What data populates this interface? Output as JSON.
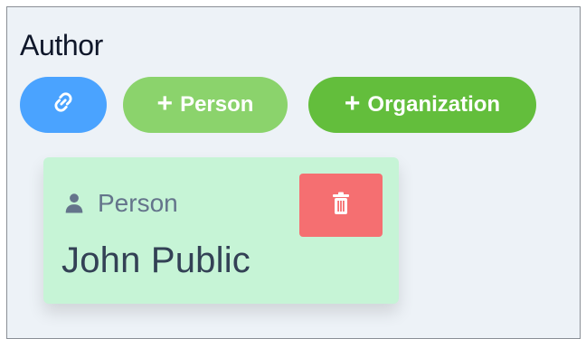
{
  "section": {
    "title": "Author"
  },
  "actions": {
    "link_icon": "link-icon",
    "add_person_label": "Person",
    "add_organization_label": "Organization",
    "plus_icon": "plus-icon"
  },
  "author_card": {
    "type_icon": "user-icon",
    "type_label": "Person",
    "name": "John Public",
    "delete_icon": "trash-icon"
  },
  "colors": {
    "link_button": "#4aa3ff",
    "person_button": "#8bd36c",
    "organization_button": "#63be3c",
    "card_background": "#c6f4d6",
    "delete_button": "#f56f71"
  }
}
